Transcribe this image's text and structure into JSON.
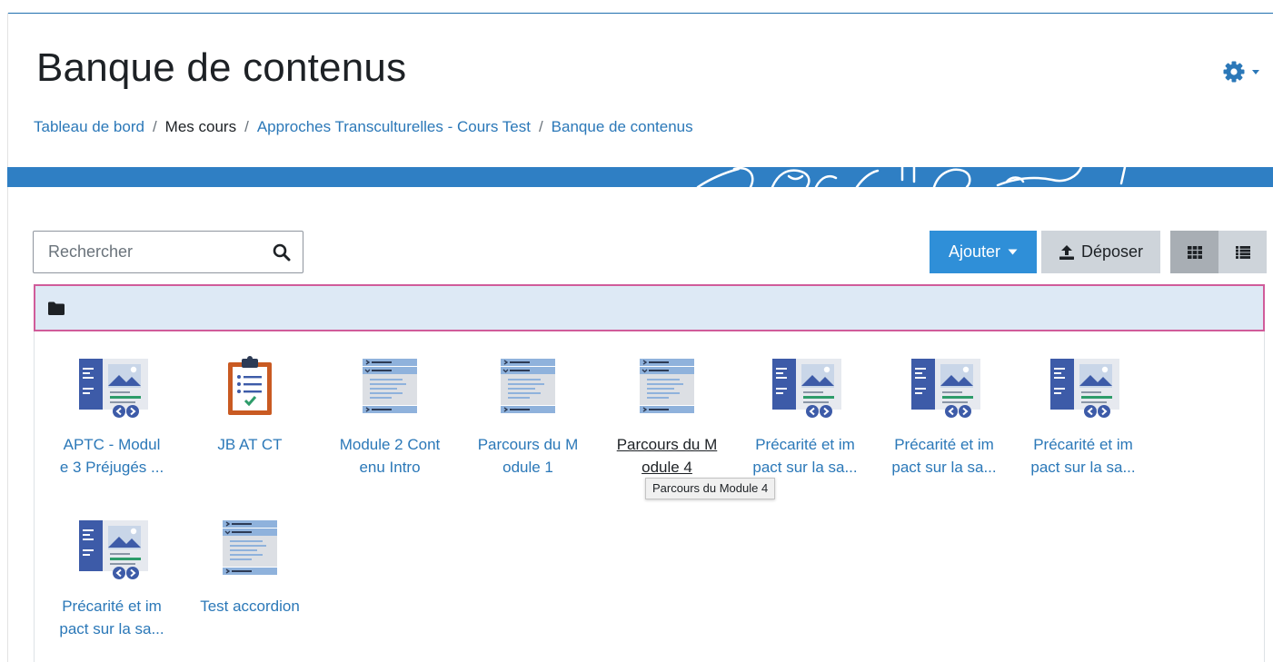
{
  "page": {
    "title": "Banque de contenus"
  },
  "breadcrumb": [
    {
      "label": "Tableau de bord",
      "link": true
    },
    {
      "label": "Mes cours",
      "link": false
    },
    {
      "label": "Approches Transculturelles - Cours Test",
      "link": true
    },
    {
      "label": "Banque de contenus",
      "link": true
    }
  ],
  "breadcrumb_separator": "/",
  "search": {
    "placeholder": "Rechercher",
    "value": ""
  },
  "toolbar": {
    "add_label": "Ajouter",
    "upload_label": "Déposer",
    "view_grid_active": true
  },
  "files": [
    {
      "name": "APTC - Module 3 Préjugés ...",
      "line1": "APTC - Modul",
      "line2": "e 3 Préjugés ...",
      "icon": "interactive-book-icon"
    },
    {
      "name": "JB AT CT",
      "line1": "JB AT CT",
      "line2": "",
      "icon": "clipboard-checklist-icon"
    },
    {
      "name": "Module 2 Contenu Intro",
      "line1": "Module 2 Cont",
      "line2": "enu Intro",
      "icon": "accordion-icon"
    },
    {
      "name": "Parcours du Module 1",
      "line1": "Parcours du M",
      "line2": "odule 1",
      "icon": "accordion-icon"
    },
    {
      "name": "Parcours du Module 4",
      "line1": "Parcours du M",
      "line2": "odule 4",
      "icon": "accordion-icon",
      "hovered": true
    },
    {
      "name": "Précarité et impact sur la sa...",
      "line1": "Précarité et im",
      "line2": "pact sur la sa...",
      "icon": "interactive-book-icon"
    },
    {
      "name": "Précarité et impact sur la sa...",
      "line1": "Précarité et im",
      "line2": "pact sur la sa...",
      "icon": "interactive-book-icon"
    },
    {
      "name": "Précarité et impact sur la sa...",
      "line1": "Précarité et im",
      "line2": "pact sur la sa...",
      "icon": "interactive-book-icon"
    },
    {
      "name": "Précarité et impact sur la sa...",
      "line1": "Précarité et im",
      "line2": "pact sur la sa...",
      "icon": "interactive-book-icon"
    },
    {
      "name": "Test accordion",
      "line1": "Test accordion",
      "line2": "",
      "icon": "accordion-icon"
    }
  ],
  "tooltip": {
    "text": "Parcours du Module 4"
  },
  "colors": {
    "link": "#2b78b8",
    "primary_button": "#2f8fd8",
    "secondary_button": "#ced4da",
    "banner": "#2f7fc4",
    "folder_bar_bg": "#dde9f5",
    "folder_bar_border": "#d05c9a",
    "book_icon_dark": "#3d5ba8",
    "book_icon_light": "#c9d6e8",
    "clipboard_orange": "#c95a22",
    "accordion_blue": "#8fb2dc"
  }
}
